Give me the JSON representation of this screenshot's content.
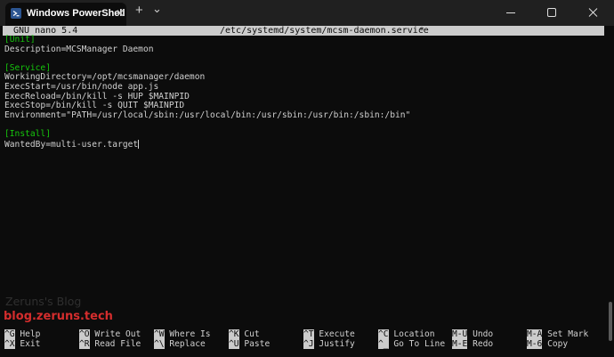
{
  "window": {
    "tab_title": "Windows PowerShell",
    "tab_close": "✕",
    "new_tab": "+",
    "tab_dropdown": "⌄"
  },
  "nano": {
    "version": "GNU nano 5.4",
    "filename": "/etc/systemd/system/mcsm-daemon.service",
    "modified": "*"
  },
  "lines": [
    {
      "text": "[Unit]",
      "kind": "section"
    },
    {
      "text": "Description=MCSManager Daemon",
      "kind": "text"
    },
    {
      "text": "",
      "kind": "text"
    },
    {
      "text": "[Service]",
      "kind": "section"
    },
    {
      "text": "WorkingDirectory=/opt/mcsmanager/daemon",
      "kind": "text"
    },
    {
      "text": "ExecStart=/usr/bin/node app.js",
      "kind": "text"
    },
    {
      "text": "ExecReload=/bin/kill -s HUP $MAINPID",
      "kind": "text"
    },
    {
      "text": "ExecStop=/bin/kill -s QUIT $MAINPID",
      "kind": "text"
    },
    {
      "text": "Environment=\"PATH=/usr/local/sbin:/usr/local/bin:/usr/sbin:/usr/bin:/sbin:/bin\"",
      "kind": "text"
    },
    {
      "text": "",
      "kind": "text"
    },
    {
      "text": "[Install]",
      "kind": "section"
    },
    {
      "text": "WantedBy=multi-user.target",
      "kind": "text"
    }
  ],
  "watermark": {
    "line1": "Zeruns's Blog",
    "line2": "blog.zeruns.tech"
  },
  "shortcuts": [
    {
      "key": "^G",
      "label": "Help"
    },
    {
      "key": "^O",
      "label": "Write Out"
    },
    {
      "key": "^W",
      "label": "Where Is"
    },
    {
      "key": "^K",
      "label": "Cut"
    },
    {
      "key": "^T",
      "label": "Execute"
    },
    {
      "key": "^C",
      "label": "Location"
    },
    {
      "key": "M-U",
      "label": "Undo"
    },
    {
      "key": "M-A",
      "label": "Set Mark"
    },
    {
      "key": "^X",
      "label": "Exit"
    },
    {
      "key": "^R",
      "label": "Read File"
    },
    {
      "key": "^\\",
      "label": "Replace"
    },
    {
      "key": "^U",
      "label": "Paste"
    },
    {
      "key": "^J",
      "label": "Justify"
    },
    {
      "key": "^_",
      "label": "Go To Line"
    },
    {
      "key": "M-E",
      "label": "Redo"
    },
    {
      "key": "M-6",
      "label": "Copy"
    }
  ],
  "colors": {
    "background": "#0c0c0c",
    "titlebar": "#202020",
    "section_header": "#16c60c",
    "watermark_red": "#d42d2d"
  }
}
